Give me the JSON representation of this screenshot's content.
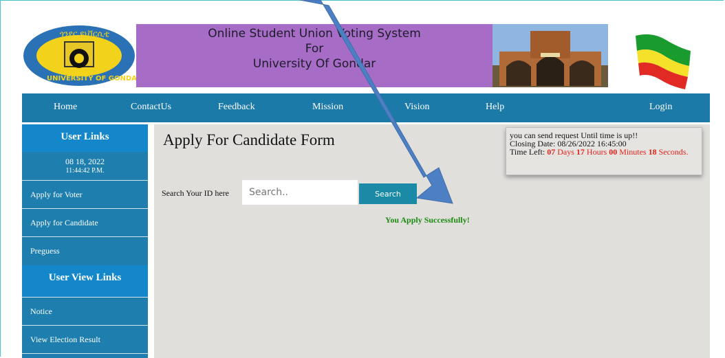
{
  "header": {
    "logo_text_top": "ጎንደር ዩኒቨርሲቲ",
    "logo_text_bottom": "UNIVERSITY OF GONDAR",
    "banner_line1": "Online Student Union Voting System",
    "banner_line2": "For",
    "banner_line3": "University Of Gondar"
  },
  "nav": {
    "home": "Home",
    "contact": "ContactUs",
    "feedback": "Feedback",
    "mission": "Mission",
    "vision": "Vision",
    "help": "Help",
    "login": "Login"
  },
  "sidebar": {
    "user_links": "User Links",
    "date": "08 18, 2022",
    "time": "11:44:42 P.M.",
    "items": [
      "Apply for Voter",
      "Apply for Candidate",
      "Preguess"
    ],
    "user_view_links": "User View Links",
    "view_items": [
      "Notice",
      "View Election Result"
    ]
  },
  "main": {
    "title": "Apply For Candidate Form",
    "search_label": "Search Your ID here",
    "search_placeholder": "Search..",
    "search_button": "Search",
    "success_message": "You Apply Successfully!"
  },
  "timer": {
    "line1": "you can send request Until time is up!!",
    "closing_label": "Closing Date:",
    "closing_value": "08/26/2022 16:45:00",
    "time_left_label": "Time Left:",
    "days": "07",
    "days_label": "Days",
    "hours": "17",
    "hours_label": "Hours",
    "minutes": "00",
    "minutes_label": "Minutes",
    "seconds": "18",
    "seconds_label": "Seconds."
  },
  "colors": {
    "nav_bg": "#1b7aa8",
    "banner_bg": "#a66cc6",
    "success": "#1d8a12",
    "timer_red": "#e32319"
  }
}
